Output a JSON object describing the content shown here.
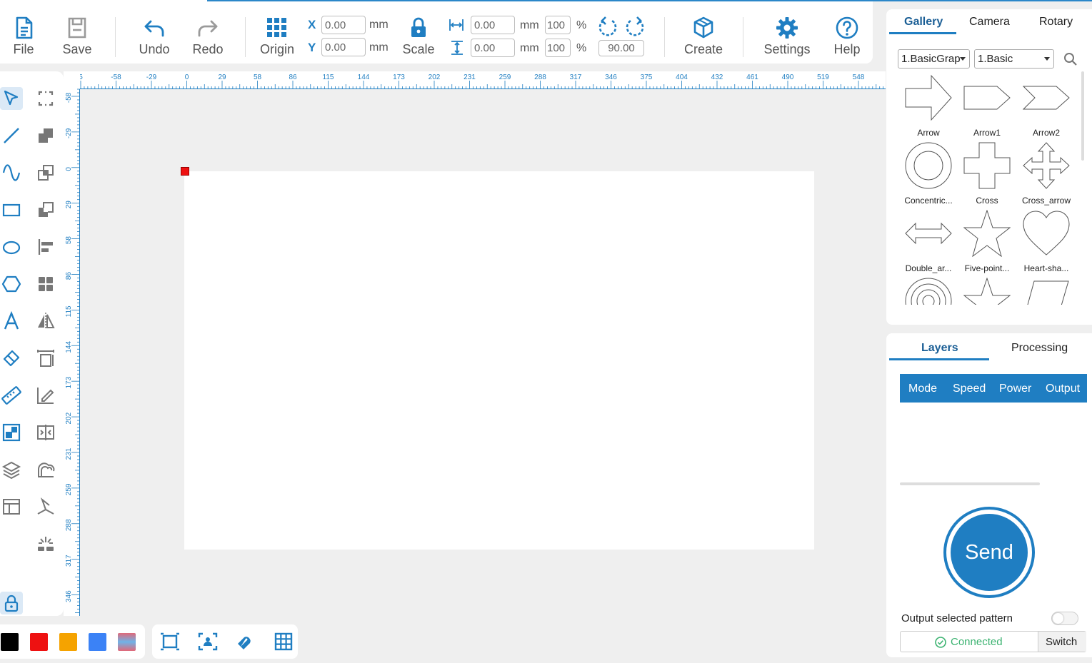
{
  "toolbar": {
    "file": "File",
    "save": "Save",
    "undo": "Undo",
    "redo": "Redo",
    "origin": "Origin",
    "scale": "Scale",
    "create": "Create",
    "settings": "Settings",
    "help": "Help",
    "x_label": "X",
    "y_label": "Y",
    "x_value": "0.00",
    "y_value": "0.00",
    "width_value": "0.00",
    "height_value": "0.00",
    "width_pct": "100",
    "height_pct": "100",
    "unit_mm": "mm",
    "unit_pct": "%",
    "rotate_value": "90.00"
  },
  "ruler": {
    "unit": "mm",
    "top_ticks": [
      "5",
      "-58",
      "-29",
      "0",
      "29",
      "58",
      "86",
      "115",
      "144",
      "173",
      "202",
      "231",
      "259",
      "288",
      "317",
      "346",
      "375",
      "404",
      "432",
      "461",
      "490",
      "519",
      "548"
    ],
    "left_ticks": [
      "-58",
      "-29",
      "0",
      "29",
      "58",
      "86",
      "115",
      "144",
      "173",
      "202",
      "231",
      "259",
      "288",
      "317",
      "346"
    ]
  },
  "colors": {
    "accent": "#1f7ec2",
    "swatches": [
      "#000000",
      "#ee1111",
      "#f5a300",
      "#3b82f6",
      "#e0697a"
    ]
  },
  "gallery": {
    "tabs": [
      "Gallery",
      "Camera",
      "Rotary"
    ],
    "category": "1.BasicGraph",
    "subcategory": "1.Basic",
    "shapes": [
      "Arrow",
      "Arrow1",
      "Arrow2",
      "Concentric...",
      "Cross",
      "Cross_arrow",
      "Double_ar...",
      "Five-point...",
      "Heart-sha..."
    ]
  },
  "layers": {
    "tabs": [
      "Layers",
      "Processing"
    ],
    "columns": [
      "Mode",
      "Speed",
      "Power",
      "Output"
    ],
    "send": "Send",
    "output_selected": "Output selected pattern",
    "status": "Connected",
    "switch": "Switch"
  }
}
